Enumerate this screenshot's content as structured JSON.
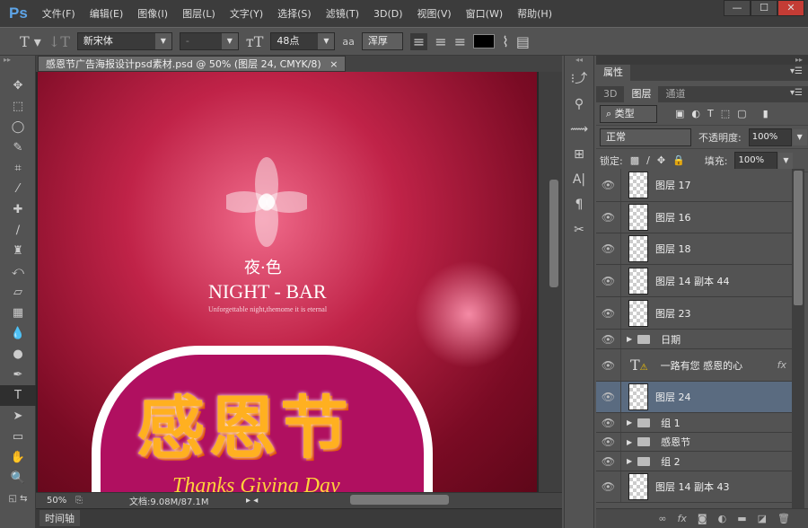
{
  "app": {
    "logo": "Ps",
    "window_buttons": [
      "—",
      "☐",
      "✕"
    ]
  },
  "menu": [
    "文件(F)",
    "编辑(E)",
    "图像(I)",
    "图层(L)",
    "文字(Y)",
    "选择(S)",
    "滤镜(T)",
    "3D(D)",
    "视图(V)",
    "窗口(W)",
    "帮助(H)"
  ],
  "options": {
    "font_family": "新宋体",
    "font_style": "-",
    "font_size": "48点",
    "antialias_label": "aa",
    "antialias": "浑厚",
    "text_color": "#000000"
  },
  "document": {
    "tab_title": "感恩节广告海报设计psd素材.psd @ 50% (图层 24, CMYK/8)",
    "close": "×",
    "zoom": "50%",
    "doc_size": "文档:9.08M/87.1M",
    "artwork_brand": "NIGHT - BAR",
    "artwork_brand_cn": "夜·色",
    "artwork_tagline": "Unforgettable night,themome it is eternal",
    "artwork_title": "感恩节",
    "artwork_subtitle": "Thanks Giving Day"
  },
  "timeline": {
    "label": "时间轴"
  },
  "panels": {
    "properties_tab": "属性",
    "tabs": [
      "3D",
      "图层",
      "通道"
    ],
    "filter_kind": "类型",
    "blend_mode": "正常",
    "opacity_label": "不透明度:",
    "opacity": "100%",
    "lock_label": "锁定:",
    "fill_label": "填充:",
    "fill": "100%",
    "layers": [
      {
        "name": "图层 17",
        "type": "pixel"
      },
      {
        "name": "图层 16",
        "type": "pixel"
      },
      {
        "name": "图层 18",
        "type": "pixel"
      },
      {
        "name": "图层 14 副本 44",
        "type": "pixel"
      },
      {
        "name": "图层 23",
        "type": "pixel"
      },
      {
        "name": "日期",
        "type": "group"
      },
      {
        "name": "一路有您 感恩的心",
        "type": "text",
        "fx": "fx"
      },
      {
        "name": "图层 24",
        "type": "pixel",
        "selected": true
      },
      {
        "name": "组 1",
        "type": "group"
      },
      {
        "name": "感恩节",
        "type": "group"
      },
      {
        "name": "组 2",
        "type": "group"
      },
      {
        "name": "图层 14 副本 43",
        "type": "pixel"
      }
    ]
  }
}
